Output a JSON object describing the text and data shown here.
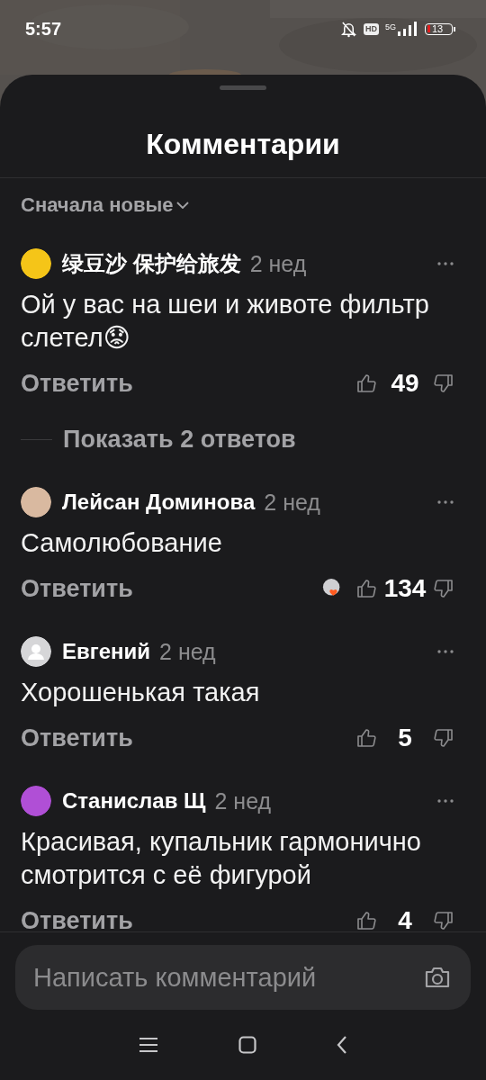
{
  "status_bar": {
    "time": "5:57",
    "hd": "HD",
    "network": "5G",
    "battery": "13",
    "silent": true
  },
  "sheet": {
    "title": "Комментарии",
    "sort": "Сначала новые"
  },
  "comments": [
    {
      "author": "绿豆沙 保护给旅发",
      "time": "2 нед",
      "text": "Ой у вас на шеи и животе фильтр слетел😟",
      "reply": "Ответить",
      "likes": "49",
      "author_heart": false,
      "replies": "Показать 2 ответов"
    },
    {
      "author": "Лейсан Доминова",
      "time": "2 нед",
      "text": "Самолюбование",
      "reply": "Ответить",
      "likes": "134",
      "author_heart": true
    },
    {
      "author": "Евгений",
      "time": "2 нед",
      "avatar": {
        "kind": "default"
      },
      "text": "Хорошенькая такая",
      "reply": "Ответить",
      "likes": "5",
      "author_heart": false
    },
    {
      "author": "Станислав Щ",
      "time": "2 нед",
      "text": "Красивая, купальник гармонично смотрится с её фигурой",
      "reply": "Ответить",
      "likes": "4",
      "author_heart": false
    }
  ],
  "composer": {
    "placeholder": "Написать комментарий"
  }
}
